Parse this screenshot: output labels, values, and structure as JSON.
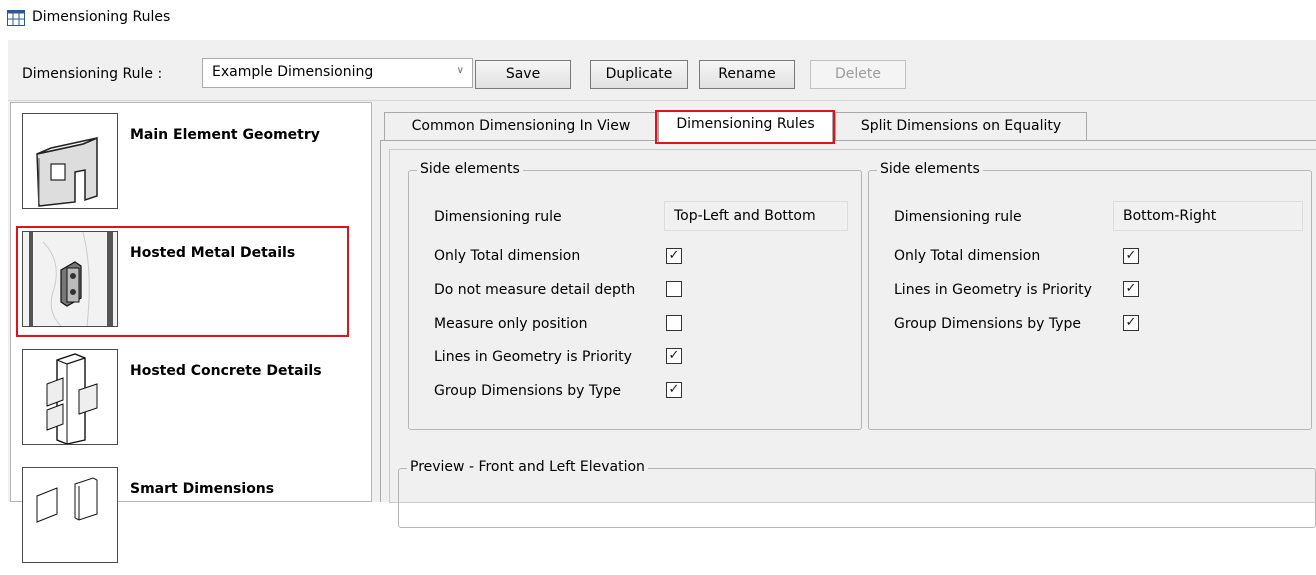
{
  "window": {
    "title": "Dimensioning Rules"
  },
  "toolbar": {
    "rule_label": "Dimensioning Rule  :",
    "rule_value": "Example Dimensioning",
    "save_label": "Save",
    "duplicate_label": "Duplicate",
    "rename_label": "Rename",
    "delete_label": "Delete"
  },
  "sidebar": {
    "items": [
      {
        "label": "Main Element Geometry",
        "icon": "main-element-geometry-icon"
      },
      {
        "label": "Hosted Metal Details",
        "icon": "hosted-metal-details-icon",
        "highlighted": true
      },
      {
        "label": "Hosted Concrete Details",
        "icon": "hosted-concrete-details-icon"
      },
      {
        "label": "Smart Dimensions",
        "icon": "smart-dimensions-icon"
      }
    ]
  },
  "tabs": [
    {
      "label": "Common Dimensioning In View"
    },
    {
      "label": "Dimensioning Rules",
      "active": true
    },
    {
      "label": "Split Dimensions on Equality"
    }
  ],
  "left_group": {
    "title": "Side elements",
    "rule_label": "Dimensioning rule",
    "rule_value": "Top-Left and Bottom",
    "options": [
      {
        "label": "Only Total dimension",
        "checked": true
      },
      {
        "label": "Do not measure detail depth",
        "checked": false
      },
      {
        "label": "Measure only position",
        "checked": false
      },
      {
        "label": "Lines in Geometry is Priority",
        "checked": true
      },
      {
        "label": "Group Dimensions by Type",
        "checked": true
      }
    ]
  },
  "right_group": {
    "title": "Side elements",
    "rule_label": "Dimensioning rule",
    "rule_value": "Bottom-Right",
    "options": [
      {
        "label": "Only Total dimension",
        "checked": true
      },
      {
        "label": "Lines in Geometry is Priority",
        "checked": true
      },
      {
        "label": "Group Dimensions by Type",
        "checked": true
      }
    ]
  },
  "preview": {
    "title": "Preview - Front and Left Elevation"
  },
  "colors": {
    "highlight": "#e0121b",
    "window_bg": "#f0f0f0"
  }
}
